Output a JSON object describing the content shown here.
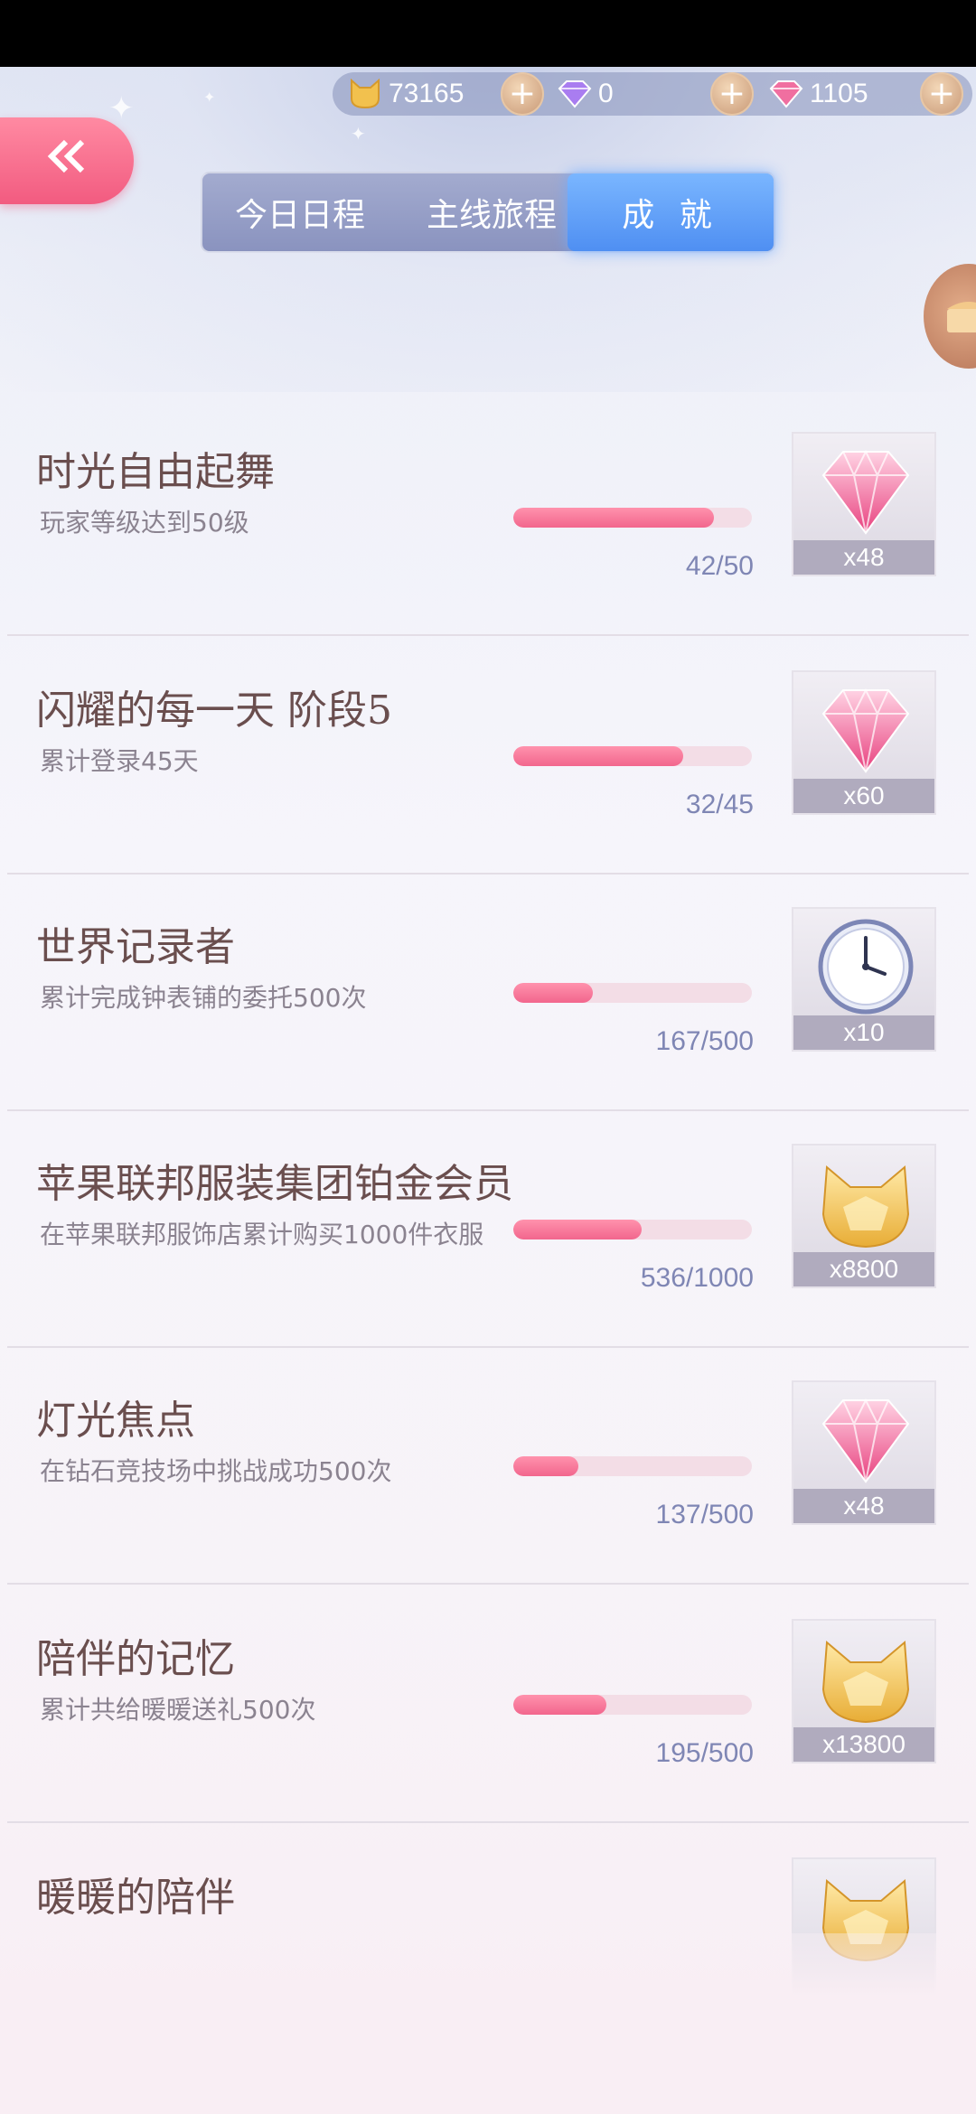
{
  "currency": {
    "gold": {
      "icon": "cat-coin-icon",
      "value": "73165"
    },
    "diamond": {
      "icon": "purple-diamond-icon",
      "value": "0"
    },
    "crystal": {
      "icon": "pink-crystal-icon",
      "value": "1105"
    }
  },
  "tabs": [
    {
      "label": "今日日程",
      "active": false
    },
    {
      "label": "主线旅程",
      "active": false
    },
    {
      "label": "成 就",
      "active": true
    }
  ],
  "achievements": [
    {
      "title": "时光自由起舞",
      "desc": "玩家等级达到50级",
      "progress_text": "42/50",
      "progress": 0.84,
      "reward_icon": "pink-crystal-icon",
      "reward_count": "x48"
    },
    {
      "title": "闪耀的每一天 阶段5",
      "desc": "累计登录45天",
      "progress_text": "32/45",
      "progress": 0.711,
      "reward_icon": "pink-crystal-icon",
      "reward_count": "x60"
    },
    {
      "title": "世界记录者",
      "desc": "累计完成钟表铺的委托500次",
      "progress_text": "167/500",
      "progress": 0.334,
      "reward_icon": "clock-icon",
      "reward_count": "x10"
    },
    {
      "title": "苹果联邦服装集团铂金会员",
      "desc": "在苹果联邦服饰店累计购买1000件衣服",
      "progress_text": "536/1000",
      "progress": 0.536,
      "reward_icon": "cat-coin-icon",
      "reward_count": "x8800"
    },
    {
      "title": "灯光焦点",
      "desc": "在钻石竞技场中挑战成功500次",
      "progress_text": "137/500",
      "progress": 0.274,
      "reward_icon": "pink-crystal-icon",
      "reward_count": "x48"
    },
    {
      "title": "陪伴的记忆",
      "desc": "累计共给暖暖送礼500次",
      "progress_text": "195/500",
      "progress": 0.39,
      "reward_icon": "cat-coin-icon",
      "reward_count": "x13800"
    },
    {
      "title": "暖暖的陪伴",
      "desc": "",
      "progress_text": "",
      "progress": 0,
      "reward_icon": "cat-coin-icon",
      "reward_count": ""
    }
  ]
}
